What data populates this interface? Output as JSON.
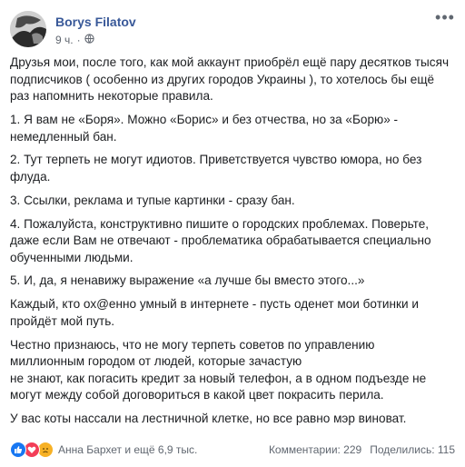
{
  "post": {
    "author": "Borys Filatov",
    "time": "9 ч.",
    "privacy_icon": "globe-icon",
    "more_icon": "more-horizontal-icon",
    "paragraphs": [
      "Друзья мои, после того, как мой аккаунт приобрёл ещё пару десятков тысяч подписчиков ( особенно из других городов Украины ), то хотелось бы ещё раз напомнить некоторые правила.",
      "1. Я вам не «Боря». Можно «Борис» и без отчества, но за «Борю» - немедленный бан.",
      "2. Тут терпеть не могут идиотов. Приветствуется чувство юмора, но без флуда.",
      "3. Ссылки, реклама и тупые картинки - сразу бан.",
      "4. Пожалуйста, конструктивно пишите о городских проблемах. Поверьте, даже если Вам не отвечают - проблематика обрабатывается специально обученными людьми.",
      "5. И, да, я ненавижу выражение «а лучше бы вместо этого...»",
      "Каждый, кто ох@енно умный в интернете - пусть оденет мои ботинки и пройдёт мой путь.",
      "Честно признаюсь, что не могу терпеть советов по управлению миллионным городом от людей, которые зачастую\nне знают, как погасить кредит за новый телефон, а в одном подъезде не могут между собой договориться в какой цвет покрасить перила.",
      "У вас коты нассали на лестничной клетке, но все равно мэр виноват."
    ]
  },
  "footer": {
    "reactions": [
      "like-icon",
      "love-icon",
      "sad-icon"
    ],
    "reacted_by": "Анна Бархет и ещё 6,9 тыс.",
    "comments": "Комментарии: 229",
    "shares": "Поделились: 115"
  },
  "colors": {
    "author": "#385898",
    "text": "#1c1e21",
    "meta": "#616770",
    "like": "#1877f2",
    "love": "#f33e58",
    "sad": "#f7b125"
  }
}
